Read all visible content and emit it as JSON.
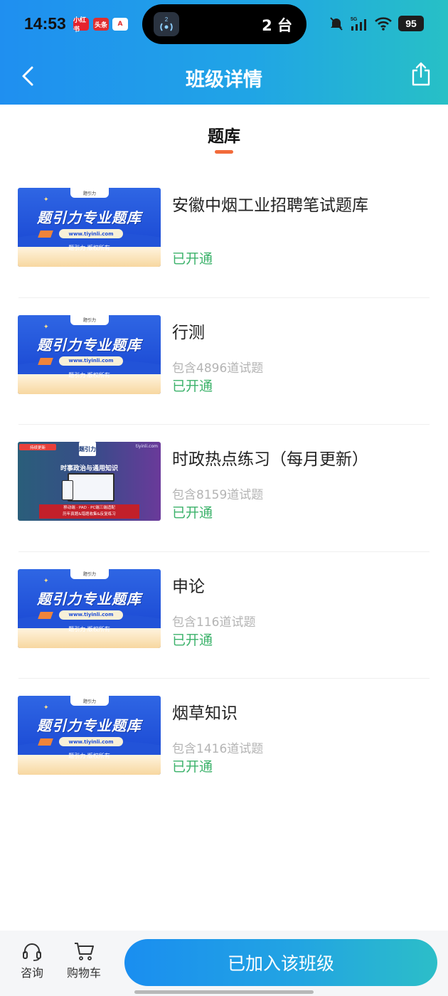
{
  "status_bar": {
    "time": "14:53",
    "app_badges": [
      "小红书",
      "头条",
      "A"
    ],
    "island_text": "2 台",
    "island_badge": "2",
    "network": "5G",
    "battery": "95"
  },
  "nav": {
    "title": "班级详情",
    "back_icon": "chevron-left-icon",
    "share_icon": "share-icon"
  },
  "section": {
    "tab_label": "题库"
  },
  "items": [
    {
      "title": "安徽中烟工业招聘笔试题库",
      "count": "",
      "status": "已开通",
      "thumb": {
        "type": "blue",
        "headline": "题引力专业题库",
        "url": "www.tiyinli.com",
        "copyright": "题引力 版权所有",
        "tag": "题引力"
      }
    },
    {
      "title": "行测",
      "count": "包含4896道试题",
      "status": "已开通",
      "thumb": {
        "type": "blue",
        "headline": "题引力专业题库",
        "url": "www.tiyinli.com",
        "copyright": "题引力 版权所有",
        "tag": "题引力"
      }
    },
    {
      "title": "时政热点练习（每月更新）",
      "count": "包含8159道试题",
      "status": "已开通",
      "thumb": {
        "type": "purple",
        "corner_tag": "持续更新",
        "logo": "题引力",
        "site": "tiyinli.com",
        "subject": "时事政治与通用知识",
        "footer_line1": "移动端 · PAD · PC端三端适配",
        "footer_line2": "历年真题&错题收集&反复练习"
      }
    },
    {
      "title": "申论",
      "count": "包含116道试题",
      "status": "已开通",
      "thumb": {
        "type": "blue",
        "headline": "题引力专业题库",
        "url": "www.tiyinli.com",
        "copyright": "题引力 版权所有",
        "tag": "题引力"
      }
    },
    {
      "title": "烟草知识",
      "count": "包含1416道试题",
      "status": "已开通",
      "thumb": {
        "type": "blue",
        "headline": "题引力专业题库",
        "url": "www.tiyinli.com",
        "copyright": "题引力 版权所有",
        "tag": "题引力"
      }
    }
  ],
  "bottom_bar": {
    "consult_label": "咨询",
    "consult_icon": "headset-icon",
    "cart_label": "购物车",
    "cart_icon": "shopping-cart-icon",
    "join_label": "已加入该班级"
  },
  "colors": {
    "header_gradient_start": "#1f8ff0",
    "header_gradient_end": "#27c0c6",
    "status_green": "#3bb26a",
    "tab_underline": "#f26b3a"
  }
}
